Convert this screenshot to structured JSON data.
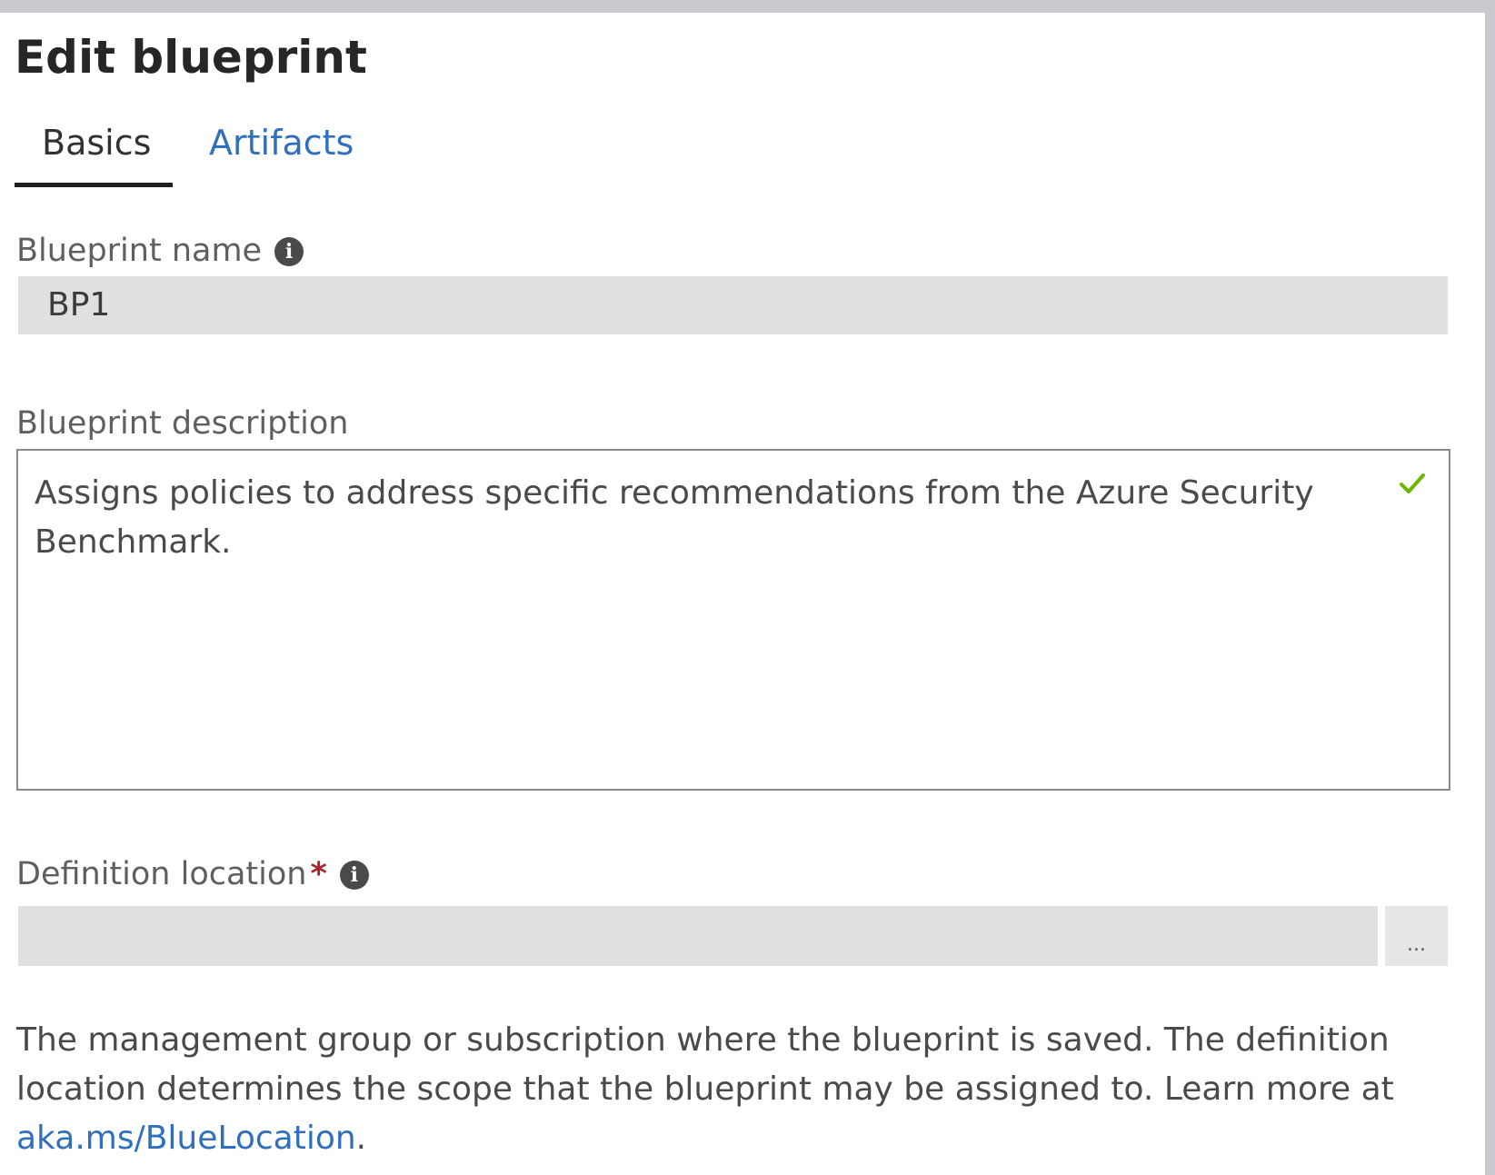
{
  "header": {
    "title": "Edit blueprint"
  },
  "tabs": [
    {
      "label": "Basics",
      "active": true
    },
    {
      "label": "Artifacts",
      "active": false
    }
  ],
  "form": {
    "blueprint_name": {
      "label": "Blueprint name",
      "value": "BP1",
      "info_icon": "info-icon"
    },
    "blueprint_description": {
      "label": "Blueprint description",
      "value": "Assigns policies to address specific recommendations from the Azure Security Benchmark.",
      "valid_icon": "checkmark-icon"
    },
    "definition_location": {
      "label": "Definition location",
      "required_mark": "*",
      "value": "",
      "browse_label": "...",
      "info_icon": "info-icon"
    }
  },
  "help": {
    "text": "The management group or subscription where the blueprint is saved. The definition location determines the scope that the blueprint may be assigned to. Learn more at ",
    "link_text": "aka.ms/BlueLocation",
    "suffix": "."
  },
  "colors": {
    "link": "#2f6fbd",
    "required": "#a4262c",
    "valid": "#6bb700",
    "field_bg": "#e0e0e0"
  }
}
